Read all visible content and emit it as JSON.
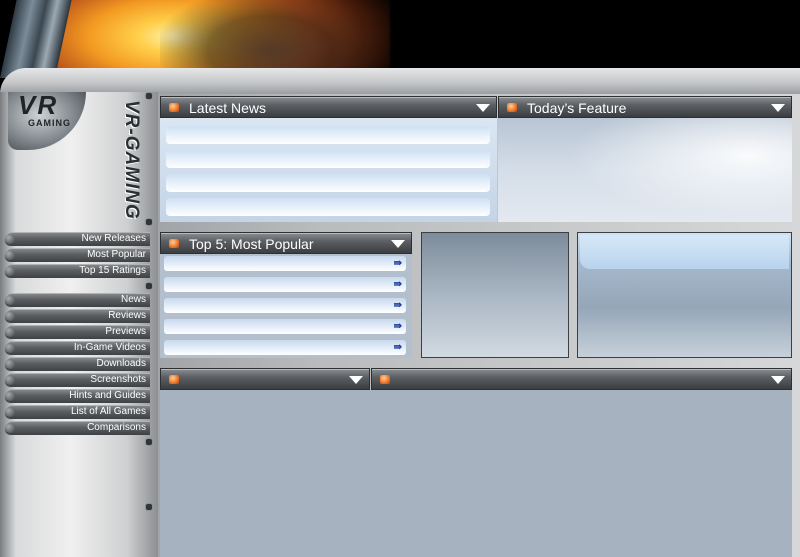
{
  "site": {
    "logo_short": "VR",
    "logo_sub": "GAMING",
    "logo_full": "VR-GAMING"
  },
  "nav": {
    "group1": [
      "New Releases",
      "Most Popular",
      "Top 15 Ratings"
    ],
    "group2": [
      "News",
      "Reviews",
      "Previews",
      "In-Game Videos",
      "Downloads",
      "Screenshots",
      "Hints and Guides",
      "List of All Games",
      "Comparisons"
    ]
  },
  "panels": {
    "latest_news": {
      "title": "Latest News",
      "lines": 4
    },
    "todays_feature": {
      "title": "Today’s Feature"
    },
    "top5": {
      "title": "Top 5: Most Popular",
      "rows": 5,
      "go_glyph": "⇛"
    },
    "bottom_left": {
      "title": ""
    },
    "bottom_right": {
      "title": ""
    }
  },
  "colors": {
    "accent_dot": "#ef7a2b",
    "header_dark": "#3b3e41",
    "link_arrow": "#1d3f9a"
  },
  "icons": {
    "panel_collapse": "chevron-down-icon",
    "panel_marker": "orange-bullet-icon",
    "row_go": "double-arrow-right-icon"
  }
}
